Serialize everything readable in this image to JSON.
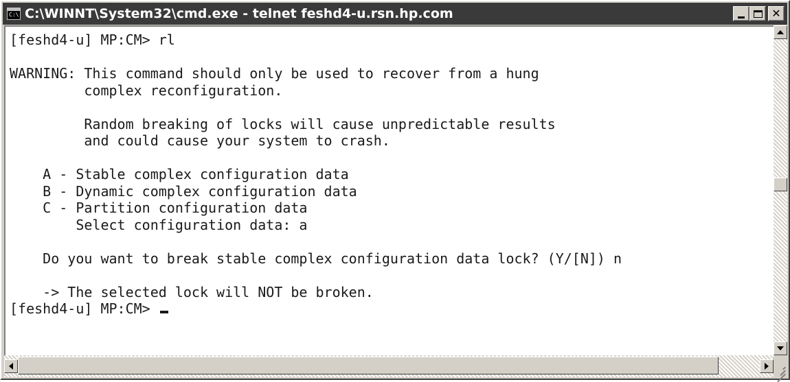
{
  "window": {
    "title": "C:\\WINNT\\System32\\cmd.exe - telnet feshd4-u.rsn.hp.com",
    "icon": "cmd-prompt-icon",
    "buttons": [
      "minimize",
      "maximize",
      "close"
    ]
  },
  "console": {
    "lines": [
      "[feshd4-u] MP:CM> rl",
      "",
      "WARNING: This command should only be used to recover from a hung",
      "         complex reconfiguration.",
      "",
      "         Random breaking of locks will cause unpredictable results",
      "         and could cause your system to crash.",
      "",
      "    A - Stable complex configuration data",
      "    B - Dynamic complex configuration data",
      "    C - Partition configuration data",
      "        Select configuration data: a",
      "",
      "    Do you want to break stable complex configuration data lock? (Y/[N]) n",
      "",
      "    -> The selected lock will NOT be broken.",
      "[feshd4-u] MP:CM> "
    ]
  },
  "scrollbars": {
    "vertical": {
      "position_fraction": 0.48
    },
    "horizontal": {
      "position_fraction": 0.0
    }
  }
}
